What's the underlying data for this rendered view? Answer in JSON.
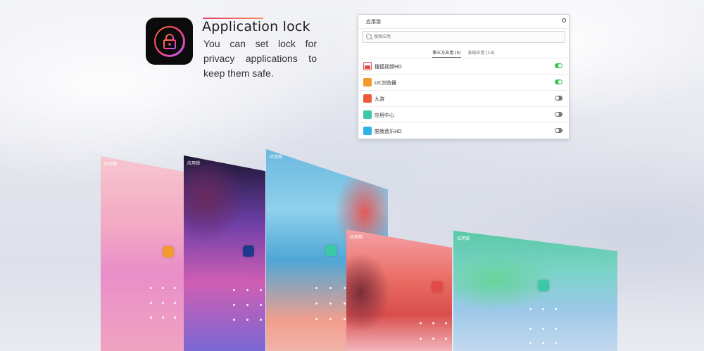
{
  "hero": {
    "icon": "padlock-icon",
    "title": "Application lock",
    "description": "You can set lock for privacy applications to keep them safe."
  },
  "panel": {
    "title": "应用锁",
    "close_icon": "close-circle-icon",
    "search_placeholder": "搜索应用",
    "tabs": [
      {
        "label": "第三方应用 (5)",
        "active": true
      },
      {
        "label": "系统应用 (14)",
        "active": false
      }
    ],
    "apps": [
      {
        "name": "搜狐视频HD",
        "locked": true,
        "icon_color": "#e24a4a"
      },
      {
        "name": "UC浏览器",
        "locked": true,
        "icon_color": "#f29a2e"
      },
      {
        "name": "九游",
        "locked": false,
        "icon_color": "#f05a3a"
      },
      {
        "name": "应用中心",
        "locked": false,
        "icon_color": "#3cc7a6"
      },
      {
        "name": "酷我音乐HD",
        "locked": false,
        "icon_color": "#2fb3e8"
      }
    ]
  },
  "colors": {
    "toggle_on": "#3bc44b",
    "toggle_off": "#777777",
    "accent_gradient_start": "#e0406a",
    "accent_gradient_end": "#ff8a55"
  },
  "tablets": [
    {
      "status_label": "应用锁",
      "app_icon_color": "#f29a2e"
    },
    {
      "status_label": "应用锁",
      "app_icon_color": "#1e3a8a"
    },
    {
      "status_label": "应用锁",
      "app_icon_color": "#3cc7a6"
    },
    {
      "status_label": "应用锁",
      "app_icon_color": "#e24a4a"
    },
    {
      "status_label": "应用锁",
      "app_icon_color": "#3cc7a6"
    }
  ]
}
